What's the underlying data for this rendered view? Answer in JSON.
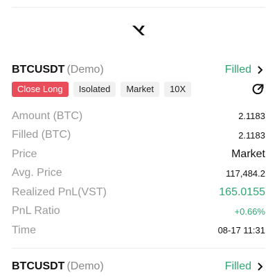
{
  "orders": [
    {
      "symbol": "BTCUSDT",
      "mode": "(Demo)",
      "status": "Filled",
      "tags": [
        "Close Long",
        "Isolated",
        "Market",
        "10X"
      ],
      "rows": [
        {
          "label": "Amount (BTC)",
          "value": "2.1183"
        },
        {
          "label": "Filled (BTC)",
          "value": "2.1183"
        },
        {
          "label": "Price",
          "value": "Market"
        },
        {
          "label": "Avg. Price",
          "value": "117,484.2"
        },
        {
          "label": "Realized PnL(VST)",
          "value": "165.0155"
        },
        {
          "label": "PnL Ratio",
          "value": "+0.66%"
        },
        {
          "label": "Time",
          "value": "08-17 11:31"
        }
      ]
    },
    {
      "symbol": "BTCUSDT",
      "mode": "(Demo)",
      "status": "Filled"
    }
  ],
  "colors": {
    "accent_green": "#2ea673",
    "close_long_red": "#ea4d5a"
  },
  "icons": {
    "logo": "app-logo",
    "status": "chevron-right-icon",
    "share": "share-icon"
  }
}
